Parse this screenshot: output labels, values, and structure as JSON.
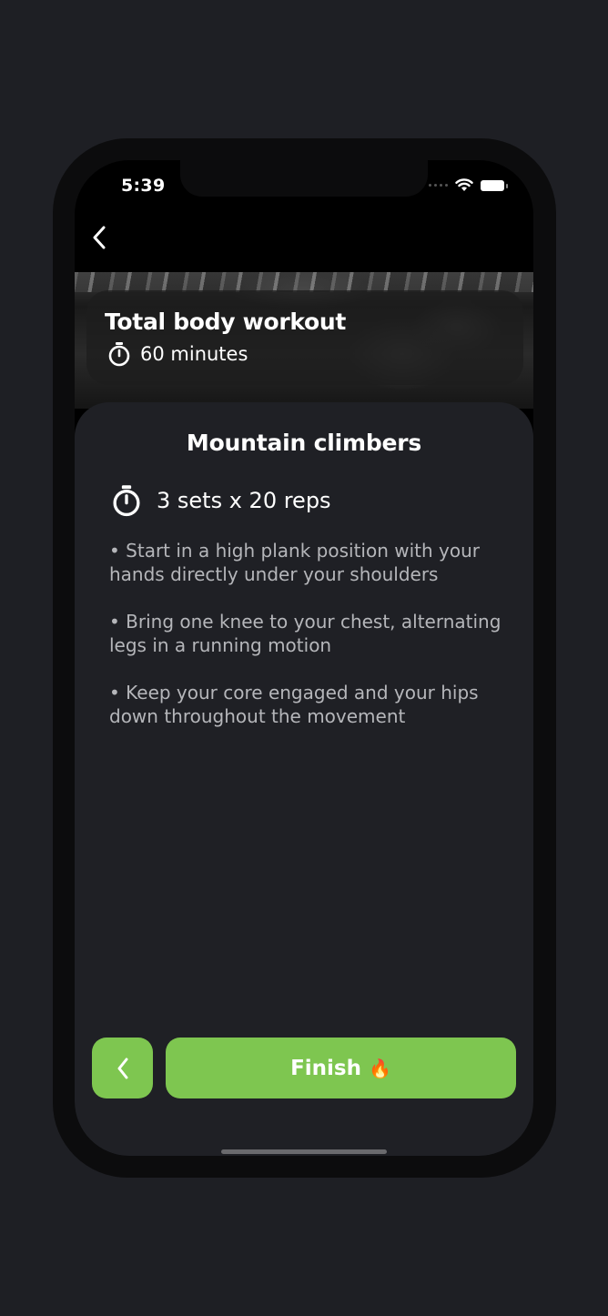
{
  "status_bar": {
    "time": "5:39",
    "icons": [
      "signal-dots-icon",
      "wifi-icon",
      "battery-icon"
    ]
  },
  "nav": {
    "back_icon": "chevron-left-icon"
  },
  "workout": {
    "title": "Total body workout",
    "duration": "60 minutes",
    "duration_icon": "stopwatch-icon"
  },
  "exercise": {
    "name": "Mountain climbers",
    "sets_reps": "3 sets x 20 reps",
    "sets_icon": "stopwatch-icon",
    "instructions": [
      "• Start in a high plank position with your hands directly under your shoulders",
      "• Bring one knee to your chest, alternating legs in a running motion",
      "• Keep your core engaged and your hips down throughout the movement"
    ]
  },
  "actions": {
    "prev_icon": "chevron-left-icon",
    "finish_label": "Finish",
    "finish_emoji": "🔥"
  },
  "colors": {
    "accent": "#7ec650",
    "card_background": "#1f2025",
    "page_background": "#1e1f24"
  }
}
